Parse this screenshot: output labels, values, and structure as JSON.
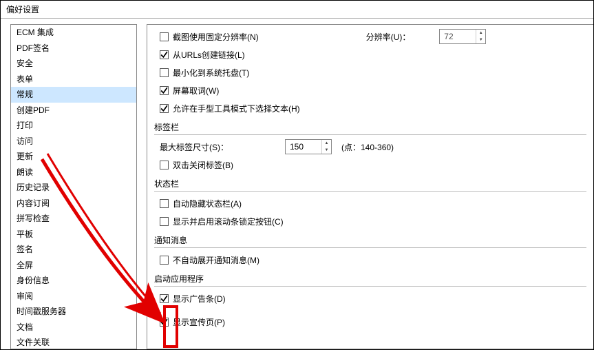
{
  "window": {
    "title": "偏好设置"
  },
  "sidebar": {
    "items": [
      "ECM 集成",
      "PDF签名",
      "安全",
      "表单",
      "常规",
      "创建PDF",
      "打印",
      "访问",
      "更新",
      "朗读",
      "历史记录",
      "内容订阅",
      "拼写检查",
      "平板",
      "签名",
      "全屏",
      "身份信息",
      "审阅",
      "时间戳服务器",
      "文档",
      "文件关联"
    ],
    "selected_index": 4
  },
  "options": {
    "fixed_res": {
      "label": "截图使用固定分辨率(N)",
      "checked": false
    },
    "resolution_label": "分辨率(U)：",
    "resolution_value": "72",
    "from_urls": {
      "label": "从URLs创建链接(L)",
      "checked": true
    },
    "min_tray": {
      "label": "最小化到系统托盘(T)",
      "checked": false
    },
    "screen_word": {
      "label": "屏幕取词(W)",
      "checked": true
    },
    "hand_tool": {
      "label": "允许在手型工具模式下选择文本(H)",
      "checked": true
    }
  },
  "tabbar": {
    "title": "标签栏",
    "max_label": "最大标签尺寸(S)：",
    "max_value": "150",
    "hint": "(点：140-360)",
    "dblclick_close": {
      "label": "双击关闭标签(B)",
      "checked": false
    }
  },
  "statusbar": {
    "title": "状态栏",
    "auto_hide": {
      "label": "自动隐藏状态栏(A)",
      "checked": false
    },
    "scroll_lock": {
      "label": "显示并启用滚动条锁定按钮(C)",
      "checked": false
    }
  },
  "notify": {
    "title": "通知消息",
    "no_auto_expand": {
      "label": "不自动展开通知消息(M)",
      "checked": false
    }
  },
  "startup": {
    "title": "启动应用程序",
    "show_ad": {
      "label": "显示广告条(D)",
      "checked": true
    },
    "show_promo": {
      "label": "显示宣传页(P)",
      "checked": true
    }
  }
}
